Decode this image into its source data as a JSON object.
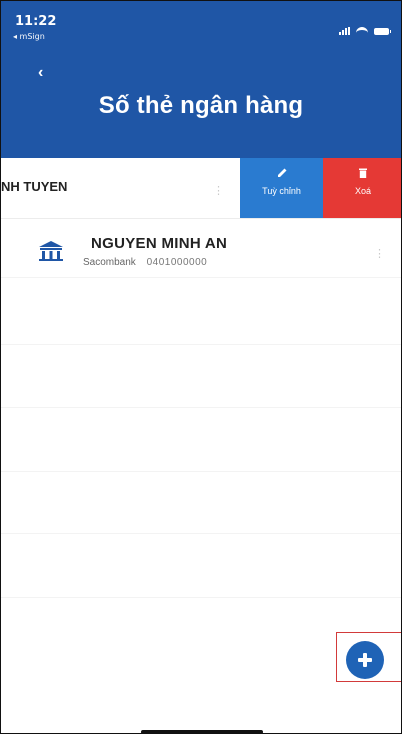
{
  "status_bar": {
    "time": "11:22",
    "back_app_label": "◂ mSign"
  },
  "header": {
    "back_icon": "chevron-left-icon",
    "title": "Số thẻ ngân hàng"
  },
  "accounts": [
    {
      "name_visible": "NH TUYEN",
      "more_icon": "more-vertical-icon",
      "actions": [
        {
          "label": "Tuỳ chỉnh",
          "icon": "pencil-icon",
          "color": "#2a7bd0"
        },
        {
          "label": "Xoá",
          "icon": "trash-icon",
          "color": "#e53935"
        }
      ]
    },
    {
      "name": "NGUYEN MINH AN",
      "bank_name": "Sacombank",
      "account_number_masked": "0401000000",
      "bank_icon": "bank-icon",
      "more_icon": "more-vertical-icon"
    }
  ],
  "fab": {
    "icon": "plus-icon",
    "color": "#1f63b6"
  },
  "colors": {
    "header": "#1f56a6",
    "highlight": "#d23a3a"
  }
}
